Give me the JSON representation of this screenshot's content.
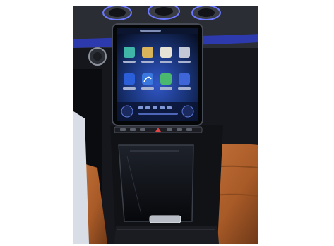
{
  "screen": {
    "apps_row1": [
      {
        "label": "",
        "icon": "app-icon-1"
      },
      {
        "label": "",
        "icon": "app-icon-2"
      },
      {
        "label": "",
        "icon": "app-icon-3"
      },
      {
        "label": "",
        "icon": "app-icon-4"
      }
    ],
    "apps_row2": [
      {
        "label": "",
        "icon": "app-icon-5"
      },
      {
        "label": "",
        "icon": "app-icon-6"
      },
      {
        "label": "",
        "icon": "app-icon-7"
      },
      {
        "label": "",
        "icon": "app-icon-8"
      }
    ]
  },
  "colors": {
    "ambient_blue": "#3a4dff",
    "leather_tan": "#b4642e",
    "screen_glow": "#1c3d92"
  }
}
